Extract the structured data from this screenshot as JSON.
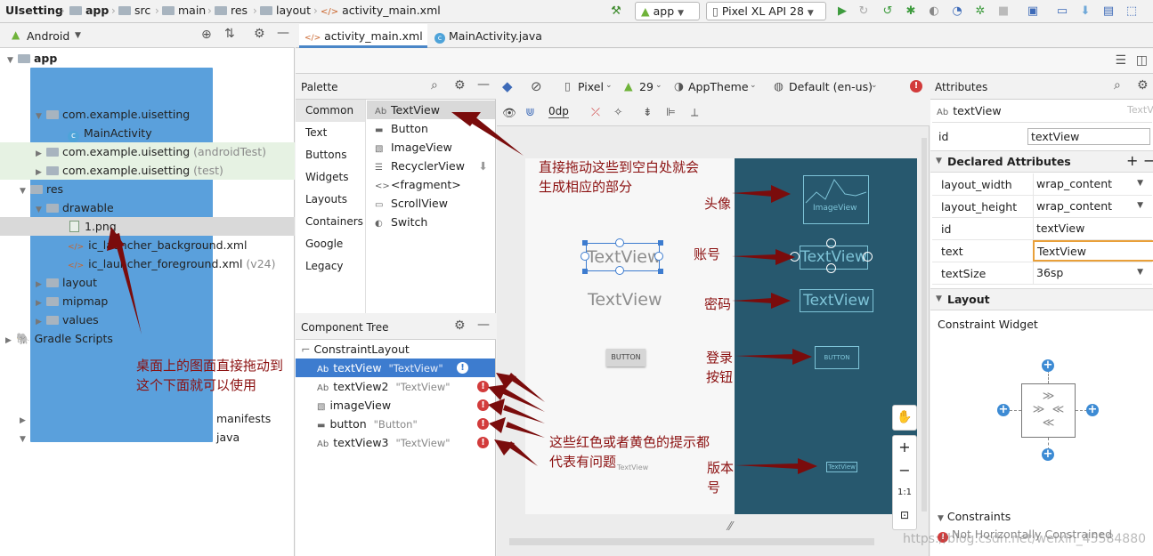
{
  "breadcrumb": [
    "UIsetting",
    "app",
    "src",
    "main",
    "res",
    "layout",
    "activity_main.xml"
  ],
  "toolbar": {
    "config": "app",
    "device": "Pixel XL API 28"
  },
  "project_view": "Android",
  "tree": [
    {
      "label": "app",
      "suffix": ""
    },
    {
      "label": "manifests",
      "suffix": ""
    },
    {
      "label": "java",
      "suffix": ""
    },
    {
      "label": "com.example.uisetting",
      "suffix": ""
    },
    {
      "label": "MainActivity",
      "suffix": ""
    },
    {
      "label": "com.example.uisetting",
      "suffix": "(androidTest)"
    },
    {
      "label": "com.example.uisetting",
      "suffix": "(test)"
    },
    {
      "label": "res",
      "suffix": ""
    },
    {
      "label": "drawable",
      "suffix": ""
    },
    {
      "label": "1.png",
      "suffix": ""
    },
    {
      "label": "ic_launcher_background.xml",
      "suffix": ""
    },
    {
      "label": "ic_launcher_foreground.xml",
      "suffix": "(v24)"
    },
    {
      "label": "layout",
      "suffix": ""
    },
    {
      "label": "mipmap",
      "suffix": ""
    },
    {
      "label": "values",
      "suffix": ""
    },
    {
      "label": "Gradle Scripts",
      "suffix": ""
    }
  ],
  "tabs": [
    "activity_main.xml",
    "MainActivity.java"
  ],
  "palette": {
    "title": "Palette",
    "categories": [
      "Common",
      "Text",
      "Buttons",
      "Widgets",
      "Layouts",
      "Containers",
      "Google",
      "Legacy"
    ],
    "items": [
      "TextView",
      "Button",
      "ImageView",
      "RecyclerView",
      "<fragment>",
      "ScrollView",
      "Switch"
    ]
  },
  "component_tree": {
    "title": "Component Tree",
    "root": "ConstraintLayout",
    "items": [
      {
        "name": "textView",
        "text": "\"TextView\""
      },
      {
        "name": "textView2",
        "text": "\"TextView\""
      },
      {
        "name": "imageView",
        "text": ""
      },
      {
        "name": "button",
        "text": "\"Button\""
      },
      {
        "name": "textView3",
        "text": "\"TextView\""
      }
    ]
  },
  "design_toolbar": {
    "device": "Pixel",
    "api": "29",
    "theme": "AppTheme",
    "locale": "Default (en-us)",
    "margin": "0dp"
  },
  "canvas": {
    "tv1": "TextView",
    "tv2": "TextView",
    "button": "BUTTON",
    "small": "TextView"
  },
  "blueprint": {
    "image": "ImageView",
    "tv1": "TextView",
    "tv2": "TextView",
    "button": "BUTTON",
    "small": "TextView"
  },
  "zoom": {
    "reset": "1:1"
  },
  "attributes": {
    "title": "Attributes",
    "widget": "textView",
    "widget_type": "TextView",
    "id_label": "id",
    "id_value": "textView",
    "declared_title": "Declared Attributes",
    "rows": [
      {
        "k": "layout_width",
        "v": "wrap_content"
      },
      {
        "k": "layout_height",
        "v": "wrap_content"
      },
      {
        "k": "id",
        "v": "textView"
      },
      {
        "k": "text",
        "v": "TextView"
      },
      {
        "k": "textSize",
        "v": "36sp"
      }
    ],
    "layout_title": "Layout",
    "constraint_widget": "Constraint Widget",
    "constraints_title": "Constraints",
    "constraint_msg": "Not Horizontally Constrained"
  },
  "annotations": {
    "drag": [
      "直接拖动这些到空白处就会",
      "生成相应的部分"
    ],
    "avatar": "头像",
    "account": "账号",
    "password": "密码",
    "login": [
      "登录",
      "按钮"
    ],
    "version": [
      "版本",
      "号"
    ],
    "desktop": [
      "桌面上的图面直接拖动到",
      "这个下面就可以使用"
    ],
    "warn": [
      "这些红色或者黄色的提示都",
      "代表有问题"
    ]
  },
  "watermark": "https://blog.csdn.net/weixin_45584880",
  "colors": {
    "blueprint": "#27586e",
    "annotation": "#8b1010",
    "arrow": "#7a0c0c",
    "selection": "#3d7ccf"
  }
}
